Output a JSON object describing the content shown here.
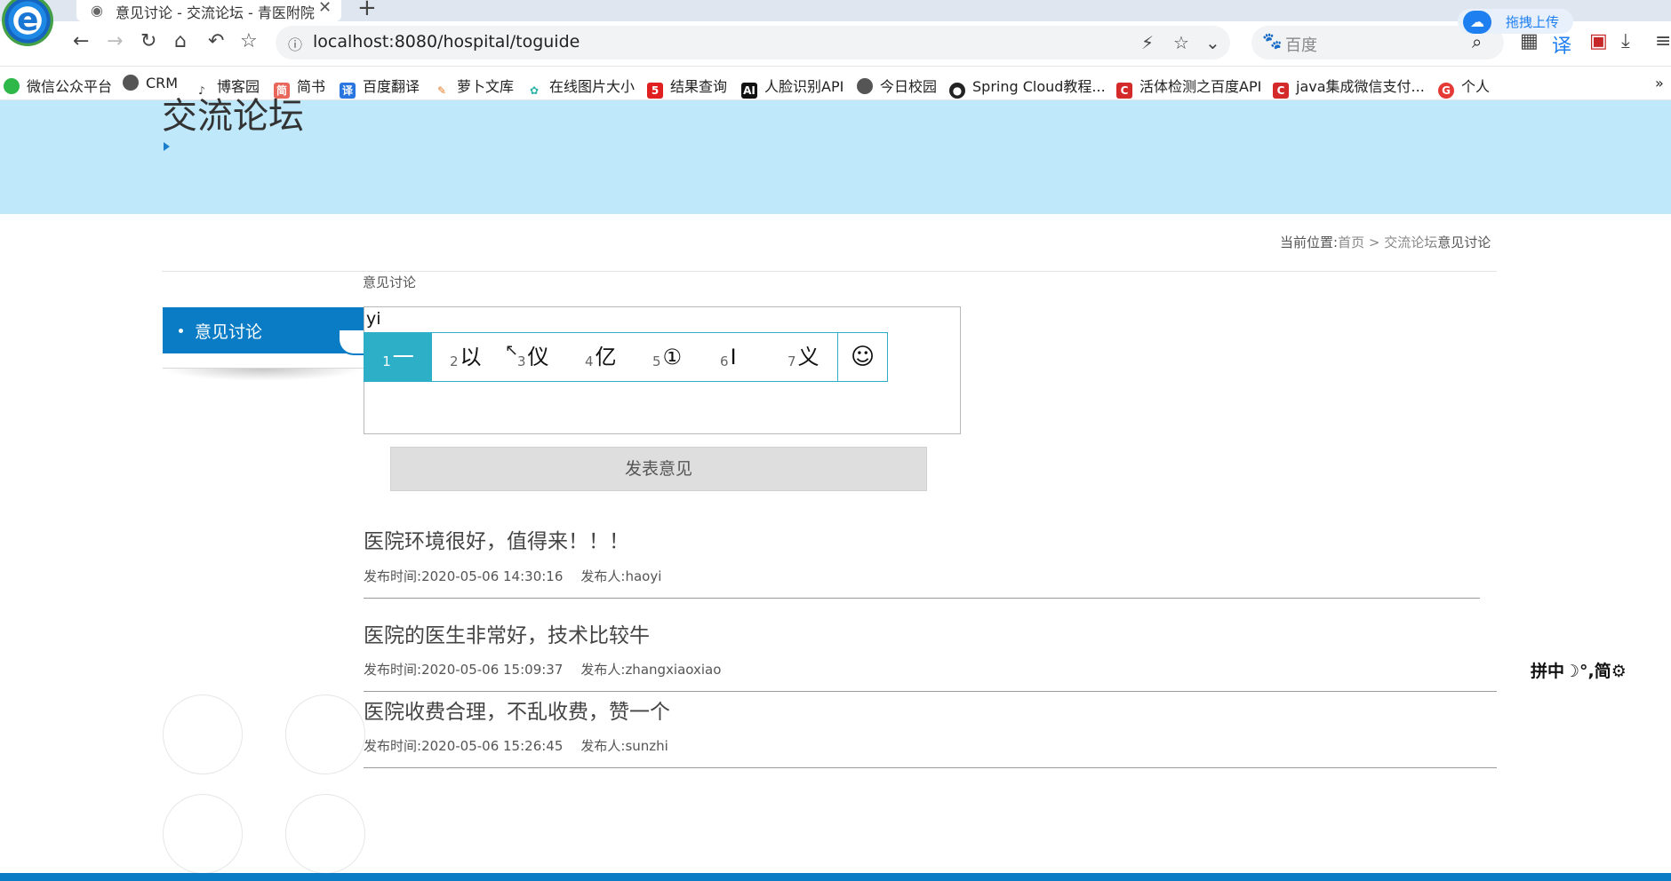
{
  "browser": {
    "tab_title": "意见讨论 - 交流论坛 - 青医附院",
    "url": "localhost:8080/hospital/toguide",
    "search_placeholder": "百度",
    "upload_label": "拖拽上传",
    "bookmarks": [
      "微信公众平台",
      "CRM",
      "博客园",
      "简书",
      "百度翻译",
      "萝卜文库",
      "在线图片大小",
      "结果查询",
      "人脸识别API",
      "今日校园",
      "Spring Cloud教程...",
      "活体检测之百度API",
      "java集成微信支付...",
      "个人"
    ],
    "bookmarks_more": "»"
  },
  "banner": {
    "title": "交流论坛"
  },
  "breadcrumb": {
    "prefix": "当前位置:",
    "home": "首页",
    "separator": " > ",
    "forum": "交流论坛",
    "current": "意见讨论"
  },
  "section_label": "意见讨论",
  "sidebar": {
    "items": [
      {
        "label": "意见讨论"
      }
    ]
  },
  "editor": {
    "typed": "yi"
  },
  "ime": {
    "candidates": [
      {
        "num": "1",
        "text": "一"
      },
      {
        "num": "2",
        "text": "以"
      },
      {
        "num": "3",
        "text": "仪"
      },
      {
        "num": "4",
        "text": "亿"
      },
      {
        "num": "5",
        "text": "①"
      },
      {
        "num": "6",
        "text": "Ⅰ"
      },
      {
        "num": "7",
        "text": "义"
      }
    ],
    "emoji": "☺",
    "toolbar": "拼中☽°,简⚙"
  },
  "submit_label": "发表意见",
  "posts": [
    {
      "title": "医院环境很好，值得来！！！",
      "time_label": "发布时间:",
      "time": "2020-05-06 14:30:16",
      "author_label": "发布人:",
      "author": "haoyi"
    },
    {
      "title": "医院的医生非常好，技术比较牛",
      "time_label": "发布时间:",
      "time": "2020-05-06 15:09:37",
      "author_label": "发布人:",
      "author": "zhangxiaoxiao"
    },
    {
      "title": "医院收费合理，不乱收费，赞一个",
      "time_label": "发布时间:",
      "time": "2020-05-06 15:26:45",
      "author_label": "发布人:",
      "author": "sunzhi"
    }
  ],
  "colors": {
    "banner": "#bfe9fb",
    "accent": "#0a7cc5",
    "ime_accent": "#2db0c7"
  }
}
